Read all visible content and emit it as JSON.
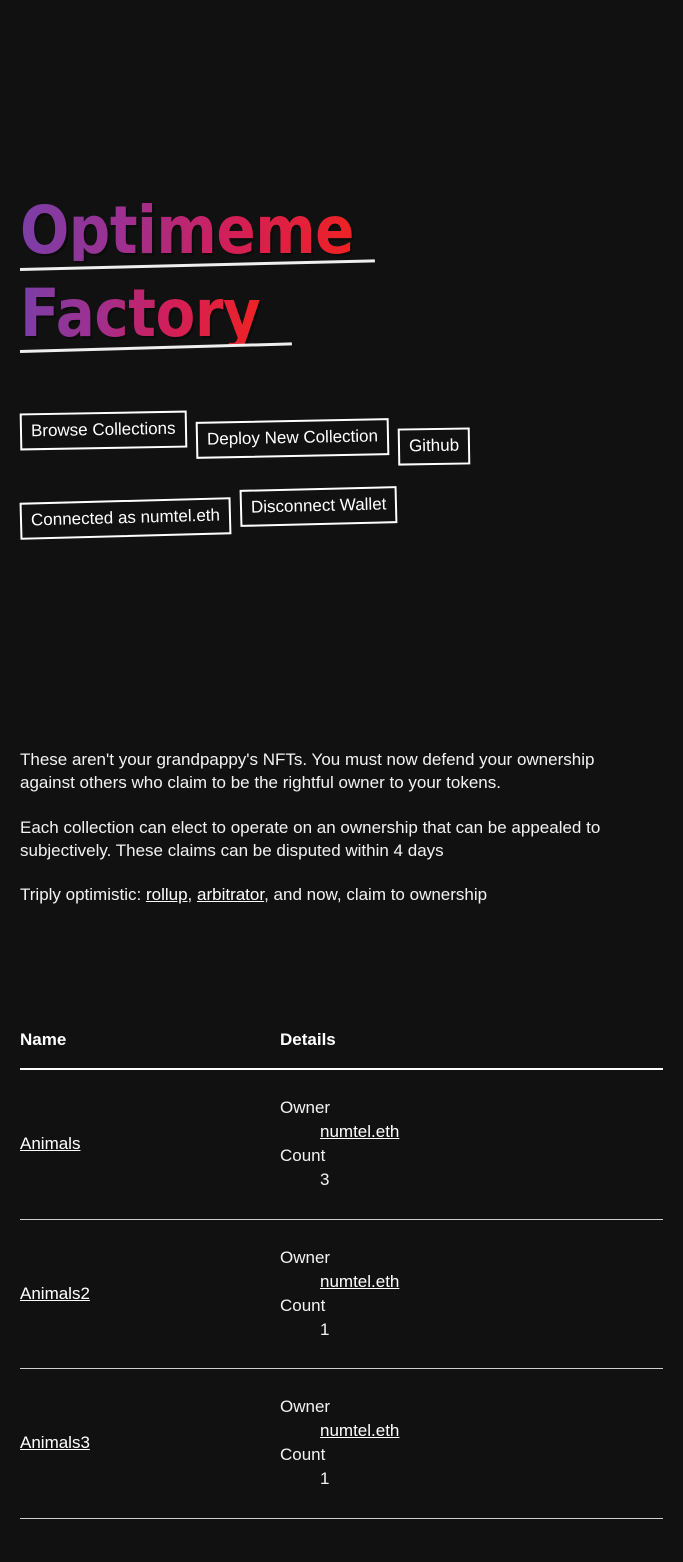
{
  "site": {
    "title_line_1": "Optimeme",
    "title_line_2": "Factory",
    "title_gradient_start": "#7a3fa8",
    "title_gradient_mid": "#d21f5a",
    "title_gradient_end": "#ef2222",
    "background_color": "#111111",
    "text_color": "#ffffff"
  },
  "nav": {
    "browse_collections": "Browse Collections",
    "deploy_new_collection": "Deploy New Collection",
    "github": "Github"
  },
  "wallet": {
    "connected_label": "Connected as numtel.eth",
    "disconnect_label": "Disconnect Wallet"
  },
  "intro": {
    "paragraph_1": "These aren't your grandpappy's NFTs. You must now defend your ownership against others who claim to be the rightful owner to your tokens.",
    "paragraph_2": "Each collection can elect to operate on an ownership that can be appealed to subjectively. These claims can be disputed within 4 days",
    "paragraph_3_prefix": "Triply optimistic: ",
    "link_rollup": "rollup",
    "paragraph_3_sep_1": ", ",
    "link_arbitrator": "arbitrator",
    "paragraph_3_suffix": ", and now, claim to ownership"
  },
  "table": {
    "headers": {
      "name": "Name",
      "details": "Details"
    },
    "detail_labels": {
      "owner": "Owner",
      "count": "Count"
    },
    "rows": [
      {
        "name": "Animals",
        "owner": "numtel.eth",
        "count": "3"
      },
      {
        "name": "Animals2",
        "owner": "numtel.eth",
        "count": "1"
      },
      {
        "name": "Animals3",
        "owner": "numtel.eth",
        "count": "1"
      }
    ]
  }
}
